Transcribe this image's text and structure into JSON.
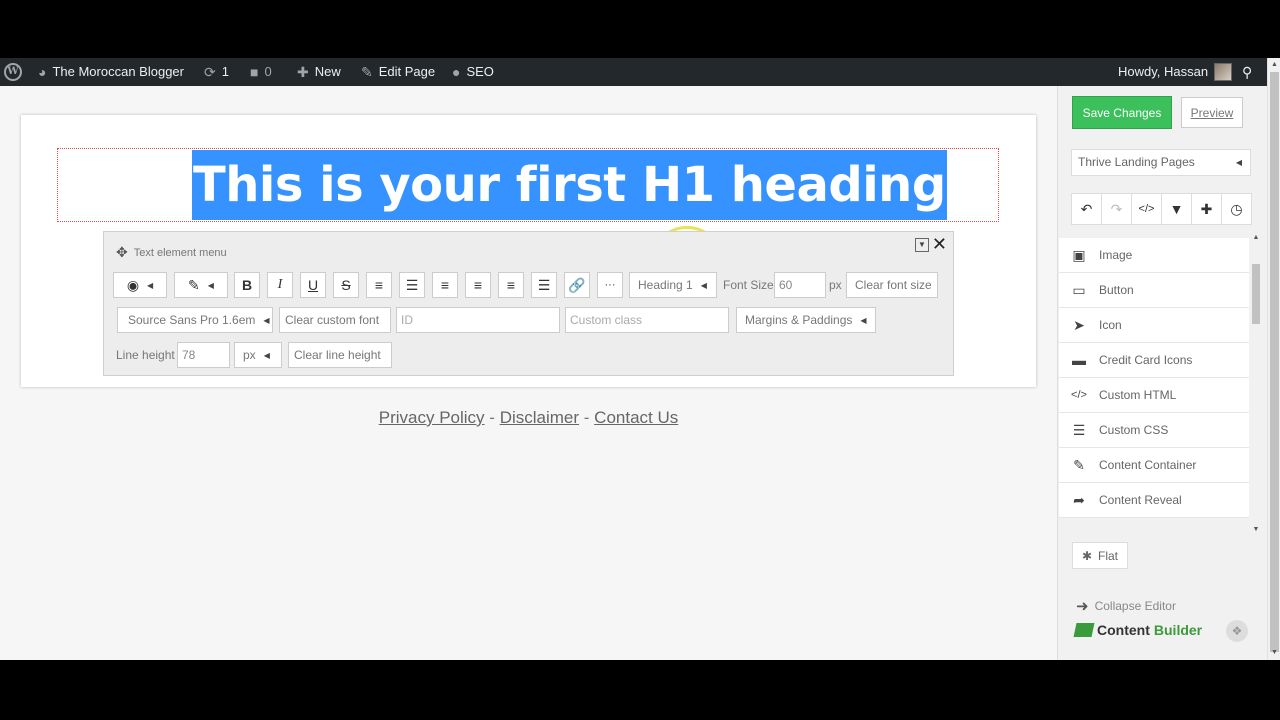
{
  "adminbar": {
    "site_name": "The Moroccan Blogger",
    "updates_count": "1",
    "comments_count": "0",
    "new_label": "New",
    "edit_page_label": "Edit Page",
    "seo_label": "SEO",
    "howdy": "Howdy, Hassan"
  },
  "page": {
    "heading": "This is your first H1 heading",
    "footer": {
      "privacy": "Privacy Policy",
      "sep1": "-",
      "disclaimer": "Disclaimer",
      "sep2": "-",
      "contact": "Contact Us"
    }
  },
  "menu": {
    "title": "Text element menu",
    "bold": "B",
    "italic": "I",
    "underline": "U",
    "strike": "S",
    "more": "···",
    "heading_select": "Heading 1",
    "font_size_label": "Font Size",
    "font_size_value": "60",
    "unit": "px",
    "clear_font_size": "Clear font size",
    "font_select": "Source Sans Pro 1.6em",
    "clear_custom_font": "Clear custom font",
    "id_placeholder": "ID",
    "class_placeholder": "Custom class",
    "margins_select": "Margins & Paddings",
    "line_height_label": "Line height",
    "line_height_value": "78",
    "line_height_unit": "px",
    "clear_line_height": "Clear line height"
  },
  "sidebar": {
    "save_label": "Save Changes",
    "preview_label": "Preview",
    "template_select": "Thrive Landing Pages",
    "elements": [
      {
        "label": "Image",
        "icon": "image-icon"
      },
      {
        "label": "Button",
        "icon": "button-icon"
      },
      {
        "label": "Icon",
        "icon": "rocket-icon"
      },
      {
        "label": "Credit Card Icons",
        "icon": "credit-card-icon"
      },
      {
        "label": "Custom HTML",
        "icon": "code-icon"
      },
      {
        "label": "Custom CSS",
        "icon": "css-icon"
      },
      {
        "label": "Content Container",
        "icon": "edit-icon"
      },
      {
        "label": "Content Reveal",
        "icon": "share-arrow-icon"
      }
    ],
    "flat_label": "Flat",
    "collapse_label": "Collapse Editor",
    "logo_text_1": "Content",
    "logo_text_2": "Builder"
  },
  "colors": {
    "accent_green": "#3cc05c",
    "selection_blue": "#3592ff",
    "adminbar_bg": "#23282d"
  }
}
